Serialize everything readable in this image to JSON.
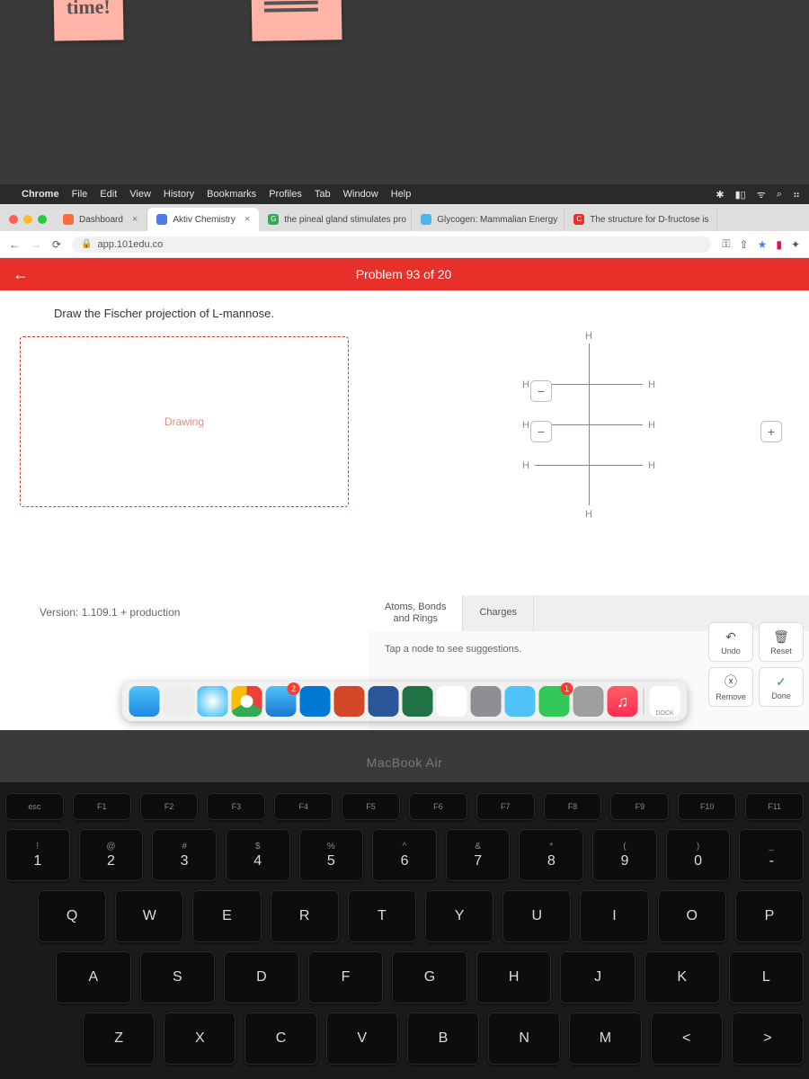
{
  "sticky_note": "time!",
  "menubar": {
    "app": "Chrome",
    "items": [
      "File",
      "Edit",
      "View",
      "History",
      "Bookmarks",
      "Profiles",
      "Tab",
      "Window",
      "Help"
    ]
  },
  "tabs": [
    {
      "label": "Dashboard",
      "favcolor": "#ff6a3d"
    },
    {
      "label": "Aktiv Chemistry",
      "favcolor": "#4a7de8",
      "active": true
    },
    {
      "label": "the pineal gland stimulates pro",
      "favcolor": "#34a853",
      "prefix": "G"
    },
    {
      "label": "Glycogen: Mammalian Energy",
      "favcolor": "#4bb6e8"
    },
    {
      "label": "The structure for D-fructose is",
      "favcolor": "#e7302a",
      "prefix": "C"
    }
  ],
  "url": "app.101edu.co",
  "header": {
    "title": "Problem 93 of 20"
  },
  "prompt": "Draw the Fischer projection of L-mannose.",
  "drawbox_label": "Drawing",
  "version": "Version: 1.109.1 +  production",
  "structure_labels": {
    "top": "H",
    "bottom": "H",
    "left": "H",
    "right": "H"
  },
  "tool_tabs": [
    {
      "label": "Atoms, Bonds\nand Rings",
      "active": true
    },
    {
      "label": "Charges",
      "active": false
    }
  ],
  "hint": "Tap a node to see suggestions.",
  "actions": {
    "undo": "Undo",
    "reset": "Reset",
    "remove": "Remove",
    "done": "Done"
  },
  "dock_label": "DOCK",
  "dock_badges": {
    "mail": "2",
    "facetime": "1"
  },
  "laptop_label": "MacBook Air",
  "fn_row": [
    "esc",
    "F1",
    "F2",
    "F3",
    "F4",
    "F5",
    "F6",
    "F7",
    "F8",
    "F9",
    "F10",
    "F11"
  ],
  "num_row": [
    {
      "t": "!",
      "b": "1"
    },
    {
      "t": "@",
      "b": "2"
    },
    {
      "t": "#",
      "b": "3"
    },
    {
      "t": "$",
      "b": "4"
    },
    {
      "t": "%",
      "b": "5"
    },
    {
      "t": "^",
      "b": "6"
    },
    {
      "t": "&",
      "b": "7"
    },
    {
      "t": "*",
      "b": "8"
    },
    {
      "t": "(",
      "b": "9"
    },
    {
      "t": ")",
      "b": "0"
    },
    {
      "t": "_",
      "b": "-"
    }
  ],
  "qwerty_row": [
    "Q",
    "W",
    "E",
    "R",
    "T",
    "Y",
    "U",
    "I",
    "O",
    "P"
  ],
  "asdf_row": [
    "A",
    "S",
    "D",
    "F",
    "G",
    "H",
    "J",
    "K",
    "L"
  ],
  "zxcv_row": [
    "Z",
    "X",
    "C",
    "V",
    "B",
    "N",
    "M",
    "<",
    ">"
  ]
}
